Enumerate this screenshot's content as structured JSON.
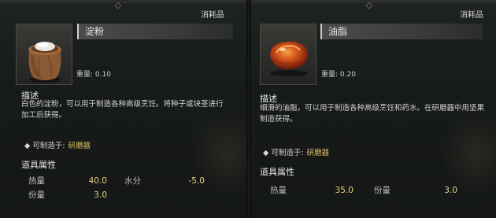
{
  "left": {
    "type_label": "消耗品",
    "name": "淀粉",
    "icon": "starch-sack-icon",
    "weight": "重量: 0.10",
    "desc_title": "描述",
    "description": "白色的淀粉，可以用于制造各种高级烹饪。将种子或块茎进行加工后获得。",
    "craft_label": "可制造于:",
    "craft_station": "研磨器",
    "props_title": "道具属性",
    "props": [
      {
        "label": "热量",
        "value": "40.0"
      },
      {
        "label": "水分",
        "value": "-5.0"
      },
      {
        "label": "份量",
        "value": "3.0"
      }
    ]
  },
  "right": {
    "type_label": "消耗品",
    "name": "油脂",
    "icon": "oil-drop-icon",
    "weight": "重量: 0.20",
    "desc_title": "描述",
    "description": "细滑的油脂，可以用于制造各种高级烹饪和药水。在研磨器中用坚果制造获得。",
    "craft_label": "可制造于:",
    "craft_station": "研磨器",
    "props_title": "道具属性",
    "props": [
      {
        "label": "热量",
        "value": "35.0"
      },
      {
        "label": "份量",
        "value": "3.0"
      }
    ]
  },
  "colors": {
    "accent_gold": "#e8d27a",
    "craft_link": "#d9c060",
    "panel_bg": "#1e2222"
  }
}
